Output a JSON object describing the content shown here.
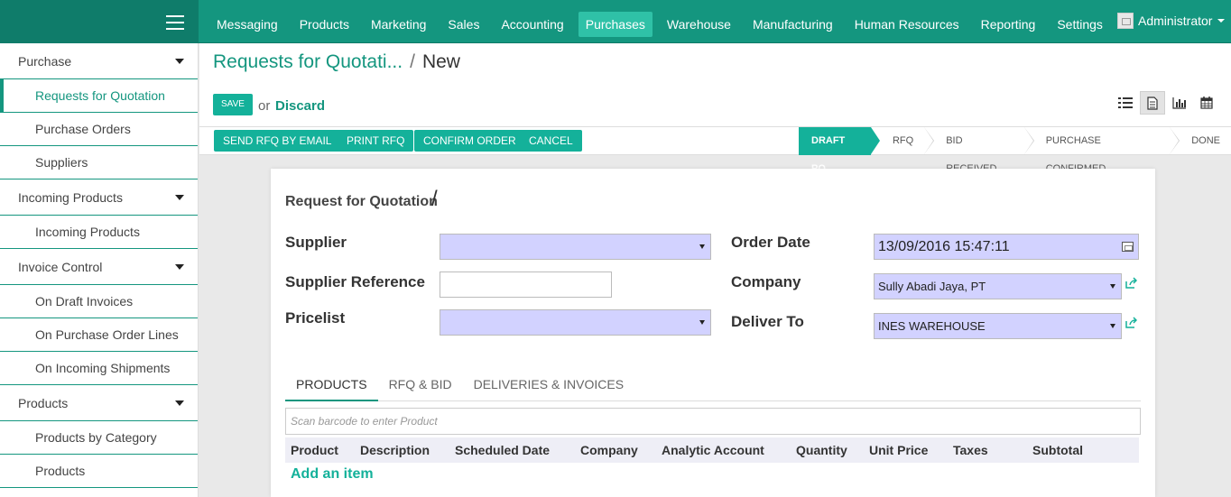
{
  "topbar": {
    "menu": [
      "Messaging",
      "Products",
      "Marketing",
      "Sales",
      "Accounting",
      "Purchases",
      "Warehouse",
      "Manufacturing",
      "Human Resources",
      "Reporting",
      "Settings"
    ],
    "active_menu": "Purchases",
    "user": "Administrator"
  },
  "sidebar": {
    "items": [
      {
        "label": "Purchase",
        "type": "group"
      },
      {
        "label": "Requests for Quotation",
        "type": "sub",
        "active": true
      },
      {
        "label": "Purchase Orders",
        "type": "sub"
      },
      {
        "label": "Suppliers",
        "type": "sub"
      },
      {
        "label": "Incoming Products",
        "type": "group"
      },
      {
        "label": "Incoming Products",
        "type": "sub"
      },
      {
        "label": "Invoice Control",
        "type": "group"
      },
      {
        "label": "On Draft Invoices",
        "type": "sub"
      },
      {
        "label": "On Purchase Order Lines",
        "type": "sub"
      },
      {
        "label": "On Incoming Shipments",
        "type": "sub"
      },
      {
        "label": "Products",
        "type": "group"
      },
      {
        "label": "Products by Category",
        "type": "sub"
      },
      {
        "label": "Products",
        "type": "sub"
      }
    ]
  },
  "breadcrumb": {
    "parent": "Requests for Quotati...",
    "separator": "/",
    "current": "New"
  },
  "actions": {
    "save": "SAVE",
    "or": "or",
    "discard": "Discard"
  },
  "views": [
    "list-view-icon",
    "form-view-icon",
    "graph-view-icon",
    "calendar-view-icon"
  ],
  "statusbar": {
    "buttons": [
      "SEND RFQ BY EMAIL",
      "PRINT RFQ",
      "CONFIRM ORDER",
      "CANCEL"
    ],
    "steps": [
      "DRAFT PO",
      "RFQ",
      "BID RECEIVED",
      "PURCHASE CONFIRMED",
      "DONE"
    ],
    "active_step": "DRAFT PO"
  },
  "form": {
    "title": "Request for Quotation",
    "title_slash": "/",
    "supplier_label": "Supplier",
    "supplier_value": "",
    "supplier_ref_label": "Supplier Reference",
    "supplier_ref_value": "",
    "pricelist_label": "Pricelist",
    "pricelist_value": "",
    "order_date_label": "Order Date",
    "order_date_value": "13/09/2016 15:47:11",
    "company_label": "Company",
    "company_value": "Sully Abadi Jaya, PT",
    "deliver_to_label": "Deliver To",
    "deliver_to_value": "INES WAREHOUSE"
  },
  "tabs": [
    "PRODUCTS",
    "RFQ & BID",
    "DELIVERIES & INVOICES"
  ],
  "barcode_placeholder": "Scan barcode to enter Product",
  "lines": {
    "columns": [
      "Product",
      "Description",
      "Scheduled Date",
      "Company",
      "Analytic Account",
      "Quantity",
      "Unit Price",
      "Taxes",
      "Subtotal"
    ],
    "add_item": "Add an item"
  },
  "colors": {
    "primary": "#14967f",
    "accent": "#14b19a",
    "required_field": "#d2d2ff"
  }
}
